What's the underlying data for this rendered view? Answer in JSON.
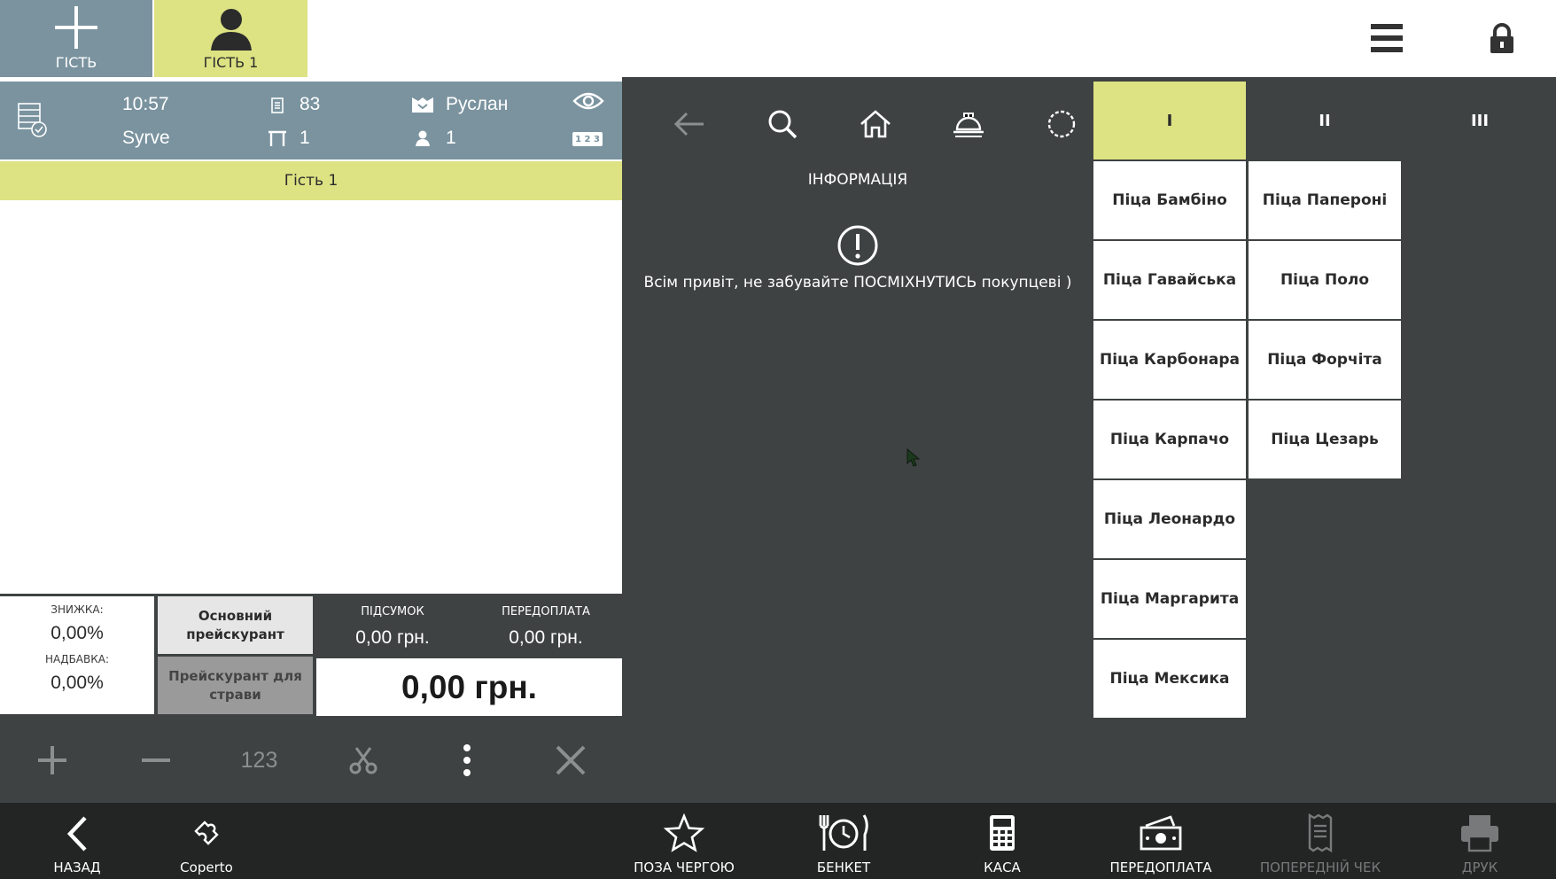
{
  "topbar": {
    "add_guest_label": "ГІСТЬ",
    "guest_tab_label": "ГІСТЬ 1"
  },
  "order": {
    "time": "10:57",
    "restaurant": "Syrve",
    "order_number": "83",
    "table_number": "1",
    "waiter": "Руслан",
    "guests_count": "1",
    "numbering_badge": "1 2 3",
    "guest_section": "Гість 1"
  },
  "totals": {
    "discount_label": "ЗНИЖКА:",
    "discount_value": "0,00%",
    "surcharge_label": "НАДБАВКА:",
    "surcharge_value": "0,00%",
    "price_list_main": "Основний прейскурант",
    "price_list_dish": "Прейскурант для страви",
    "subtotal_label": "ПІДСУМОК",
    "subtotal_value": "0,00 грн.",
    "prepayment_label": "ПЕРЕДОПЛАТА",
    "prepayment_value": "0,00 грн.",
    "grand_total": "0,00 грн."
  },
  "actions": {
    "quantity_label": "123"
  },
  "info": {
    "title": "ІНФОРМАЦІЯ",
    "message": "Всім привіт, не забувайте ПОСМІХНУТИСЬ покупцеві )"
  },
  "pages": [
    "I",
    "II",
    "III"
  ],
  "products": {
    "col1": [
      "Піца Бамбіно",
      "Піца Гавайська",
      "Піца Карбонара",
      "Піца Карпачо",
      "Піца Леонардо",
      "Піца Маргарита",
      "Піца Мексика"
    ],
    "col2": [
      "Піца Папероні",
      "Піца Поло",
      "Піца Форчіта",
      "Піца Цезарь"
    ]
  },
  "bottombar": {
    "back": "НАЗАД",
    "coperto": "Coperto",
    "out_of_queue": "ПОЗА ЧЕРГОЮ",
    "banquet": "БЕНКЕТ",
    "cash": "КАСА",
    "prepayment": "ПЕРЕДОПЛАТА",
    "pre_check": "ПОПЕРЕДНІЙ ЧЕК",
    "print": "ДРУК"
  },
  "colors": {
    "accent_yellow": "#dde283",
    "header_blue_gray": "#7a939f",
    "panel_dark": "#3e4242",
    "bottom_bar": "#232525"
  }
}
